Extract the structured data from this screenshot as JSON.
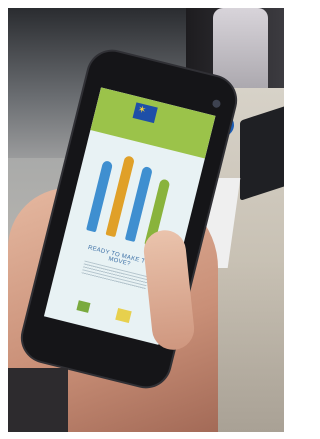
{
  "photo": {
    "description_alt": "",
    "screen": {
      "caption": "READY TO MAKE THE MOVE?"
    }
  }
}
